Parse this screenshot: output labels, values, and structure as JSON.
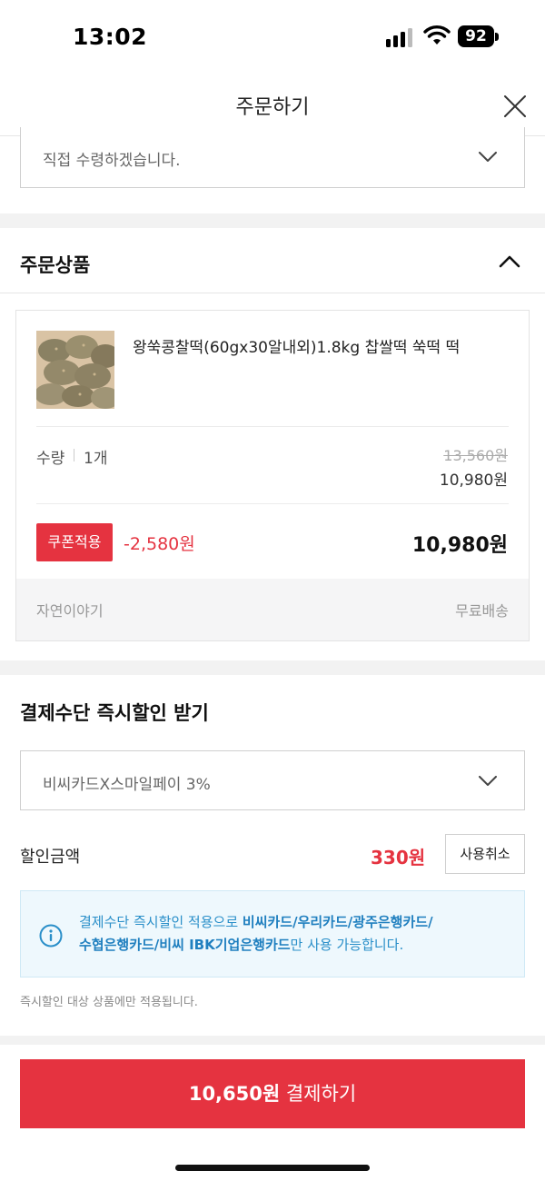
{
  "status_bar": {
    "time": "13:02",
    "battery": "92"
  },
  "header": {
    "title": "주문하기"
  },
  "delivery": {
    "selected": "직접 수령하겠습니다."
  },
  "order_items": {
    "section_title": "주문상품",
    "product": {
      "name": "왕쑥콩찰떡(60gx30알내외)1.8kg 찹쌀떡 쑥떡 떡",
      "qty_label": "수량",
      "qty_value": "1개",
      "price_original": "13,560원",
      "price_sale": "10,980원",
      "coupon_label": "쿠폰적용",
      "coupon_discount": "-2,580원",
      "price_final": "10,980원",
      "seller": "자연이야기",
      "shipping": "무료배송"
    }
  },
  "payment_discount": {
    "section_title": "결제수단 즉시할인 받기",
    "selected_option": "비씨카드X스마일페이 3%",
    "discount_label": "할인금액",
    "discount_amount": "330원",
    "cancel_label": "사용취소",
    "info_prefix": "결제수단 즉시할인 적용으로 ",
    "info_cards": "비씨카드/우리카드/광주은행카드/수협은행카드/비씨 IBK기업은행카드",
    "info_suffix": "만 사용 가능합니다.",
    "note": "즉시할인 대상 상품에만 적용됩니다."
  },
  "pay_button": {
    "amount": "10,650원",
    "label": " 결제하기"
  },
  "colors": {
    "accent": "#e53340",
    "info": "#2a8fc9",
    "info_bg": "#eef8fd"
  }
}
